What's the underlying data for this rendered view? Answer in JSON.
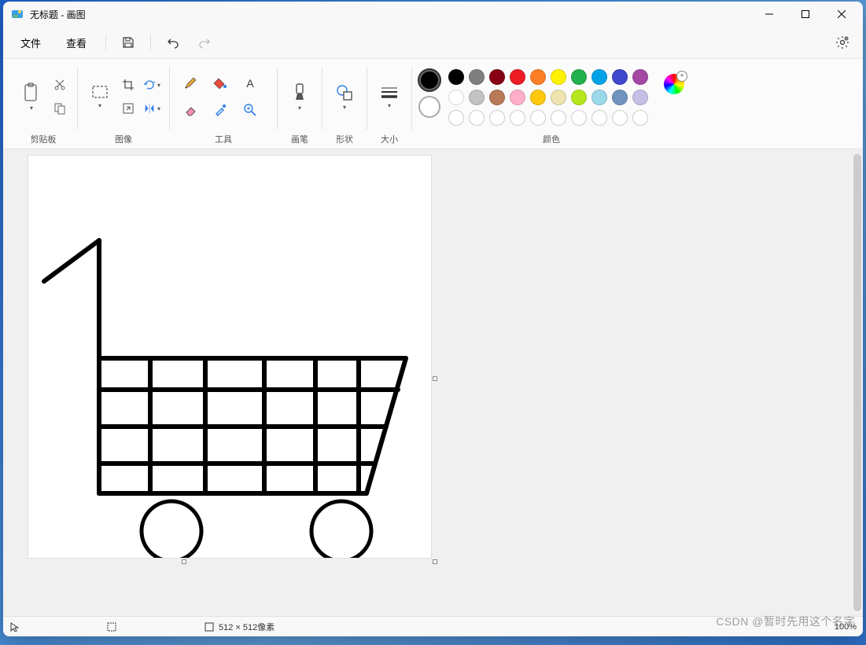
{
  "window": {
    "title": "无标题 - 画图"
  },
  "menu": {
    "file": "文件",
    "view": "查看"
  },
  "ribbon": {
    "clipboard": "剪贴板",
    "image": "图像",
    "tools": "工具",
    "brushes": "画笔",
    "shapes": "形状",
    "size": "大小",
    "colors": "颜色"
  },
  "palette": {
    "color1": "#000000",
    "color2": "#ffffff",
    "row1": [
      "#000000",
      "#7f7f7f",
      "#880015",
      "#ed1c24",
      "#ff7f27",
      "#fff200",
      "#22b14c",
      "#00a2e8",
      "#3f48cc",
      "#a349a4"
    ],
    "row2": [
      "#ffffff",
      "#c3c3c3",
      "#b97a57",
      "#ffaec9",
      "#ffc90e",
      "#efe4b0",
      "#b5e61d",
      "#99d9ea",
      "#7092be",
      "#c8bfe7"
    ]
  },
  "status": {
    "dimensions": "512 × 512像素",
    "zoom": "100%"
  },
  "watermark": "CSDN @暂时先用这个名字"
}
